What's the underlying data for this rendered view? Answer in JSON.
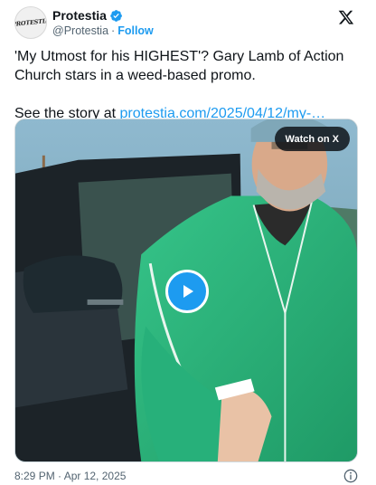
{
  "author": {
    "name": "Protestia",
    "handle": "@Protestia",
    "separator": "·",
    "follow_label": "Follow",
    "avatar_text": "PROTESTIA",
    "verified": true
  },
  "tweet": {
    "text": "'My Utmost for his HIGHEST'? Gary Lamb of Action Church stars in a weed-based promo.",
    "story_prefix": "See the story at ",
    "story_link": "protestia.com/2025/04/12/my-…"
  },
  "media": {
    "watch_label": "Watch on X",
    "play_icon": "play-icon"
  },
  "footer": {
    "timestamp": "8:29 PM · Apr 12, 2025",
    "info_icon": "info-icon"
  },
  "colors": {
    "accent": "#1d9bf0",
    "text": "#0f1419",
    "secondary": "#536471",
    "jacket": "#2aa872"
  }
}
